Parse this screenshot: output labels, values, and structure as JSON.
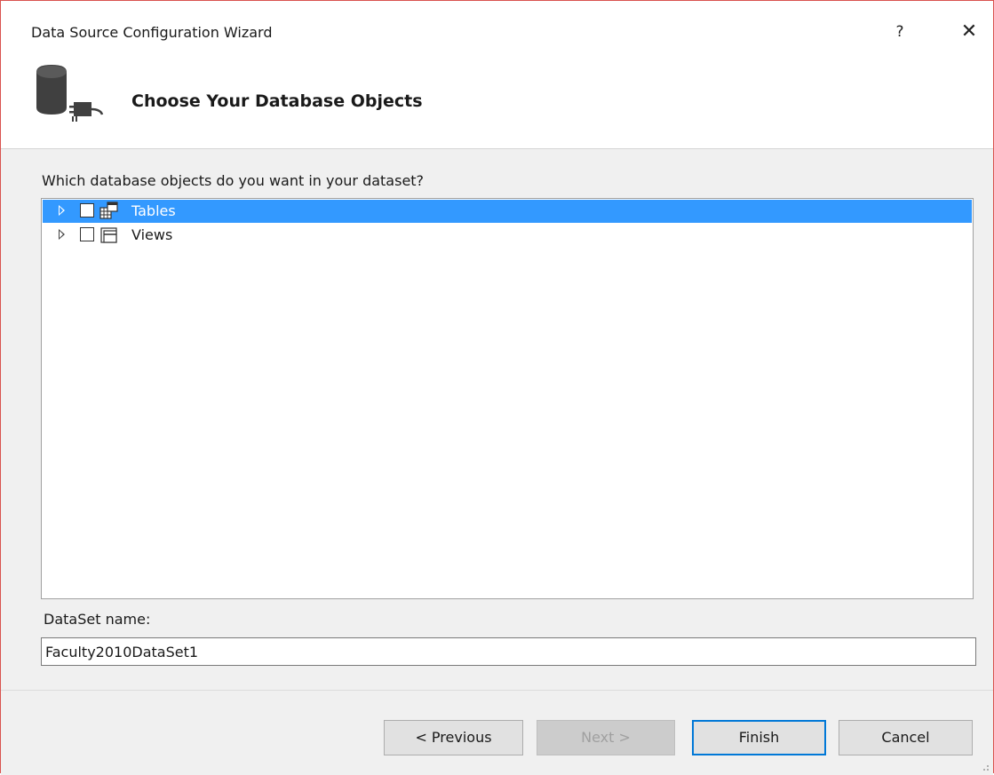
{
  "window": {
    "title": "Data Source Configuration Wizard",
    "help_label": "?",
    "close_label": "✕"
  },
  "header": {
    "title": "Choose Your Database Objects",
    "icon": "database-connection-icon"
  },
  "content": {
    "question": "Which database objects do you want in your dataset?",
    "tree": [
      {
        "label": "Tables",
        "checked": false,
        "expanded": false,
        "selected": true,
        "icon": "tables-icon"
      },
      {
        "label": "Views",
        "checked": false,
        "expanded": false,
        "selected": false,
        "icon": "views-icon"
      }
    ],
    "dataset_label": "DataSet name:",
    "dataset_value": "Faculty2010DataSet1"
  },
  "buttons": {
    "previous": "< Previous",
    "next": "Next >",
    "finish": "Finish",
    "cancel": "Cancel"
  },
  "colors": {
    "selection": "#3399ff",
    "accent": "#0078d7",
    "border_accent": "#d9534f"
  }
}
